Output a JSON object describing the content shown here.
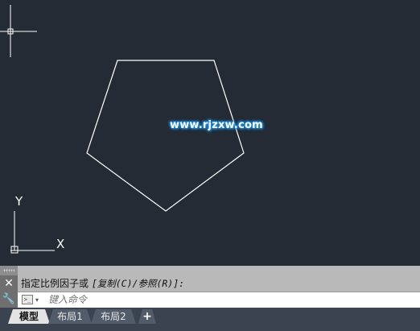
{
  "viewport": {
    "ucs_x_label": "X",
    "ucs_y_label": "Y",
    "watermark": "www.rjzxw.com"
  },
  "command_line": {
    "history_prefix": "指定比例因子或 ",
    "history_options": "[复制(C)/参照(R)]:",
    "input_placeholder": "键入命令",
    "close_glyph": "✕",
    "wrench_glyph": "🔧",
    "prompt_icon_glyph": ">_",
    "dropdown_glyph": "▾"
  },
  "layout_tabs": {
    "tabs": [
      "模型",
      "布局1",
      "布局2"
    ],
    "active": "模型",
    "add_glyph": "+"
  },
  "colors": {
    "canvas_bg": "#252b34",
    "drawing_line": "#ffffff",
    "watermark_glow": "#1e8fe0",
    "tab_bar": "#3b4350"
  }
}
